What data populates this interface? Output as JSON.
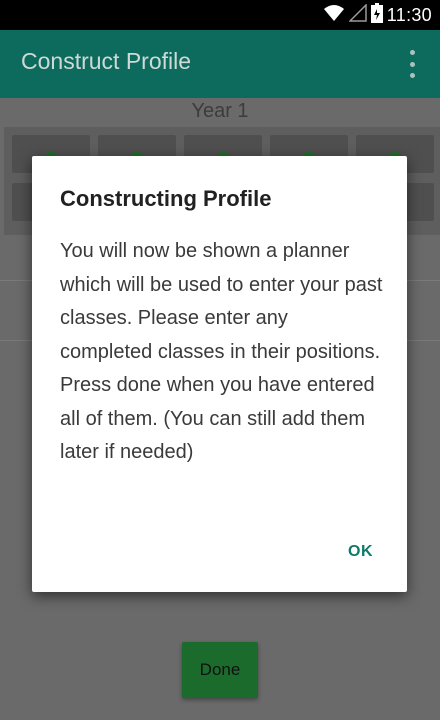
{
  "status_bar": {
    "time": "11:30",
    "icons": [
      "wifi-icon",
      "signal-icon",
      "battery-icon"
    ]
  },
  "app_bar": {
    "title": "Construct Profile",
    "menu_icon": "overflow-menu-icon",
    "color": "#0d6b5d"
  },
  "planner": {
    "year_label": "Year 1"
  },
  "dialog": {
    "title": "Constructing Profile",
    "message": "You will now be shown a planner which will be used to enter your past classes. Please enter any completed classes in their positions. Press done when you have entered all of them. (You can still add them later if needed)",
    "ok_label": "OK",
    "accent": "#0d7a6a"
  },
  "done_button": {
    "label": "Done",
    "color": "#1a6b2c"
  }
}
